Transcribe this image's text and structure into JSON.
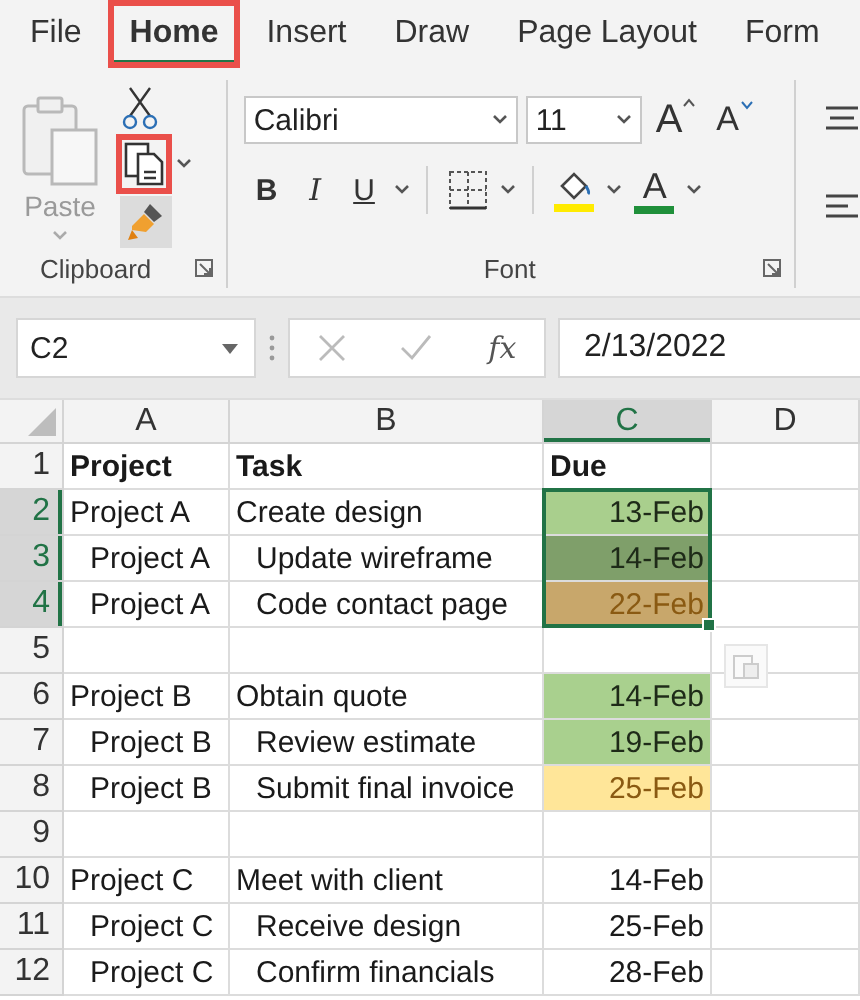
{
  "tabs": [
    {
      "label": "File",
      "selected": false,
      "highlighted": false
    },
    {
      "label": "Home",
      "selected": true,
      "highlighted": true
    },
    {
      "label": "Insert",
      "selected": false,
      "highlighted": false
    },
    {
      "label": "Draw",
      "selected": false,
      "highlighted": false
    },
    {
      "label": "Page Layout",
      "selected": false,
      "highlighted": false
    },
    {
      "label": "Form",
      "selected": false,
      "highlighted": false
    }
  ],
  "clipboard": {
    "paste_label": "Paste",
    "paste_disabled": true,
    "copy_highlighted": true,
    "group_label": "Clipboard"
  },
  "font": {
    "name": "Calibri",
    "size": "11",
    "grow": "A",
    "shrink": "A",
    "bold": "B",
    "italic": "I",
    "underline": "U",
    "font_color": "A",
    "group_label": "Font"
  },
  "formula_bar": {
    "name_box": "C2",
    "fx": "fx",
    "value": "2/13/2022"
  },
  "columns": [
    {
      "label": "A",
      "selected": false
    },
    {
      "label": "B",
      "selected": false
    },
    {
      "label": "C",
      "selected": true
    },
    {
      "label": "D",
      "selected": false
    }
  ],
  "rows": [
    {
      "number": "1",
      "kind": "header",
      "selected": false,
      "indented": false,
      "project": "Project",
      "task": "Task",
      "due": {
        "text": "Due"
      }
    },
    {
      "number": "2",
      "kind": "item",
      "selected": true,
      "indented": false,
      "project": "Project A",
      "task": "Create design",
      "due": {
        "text": "13-Feb",
        "color": "#a9cf8d",
        "kind": "good"
      }
    },
    {
      "number": "3",
      "kind": "item",
      "selected": true,
      "indented": true,
      "project": "Project A",
      "task": "Update wireframe",
      "due": {
        "text": "14-Feb",
        "color": "#7f9f6a",
        "kind": "good"
      }
    },
    {
      "number": "4",
      "kind": "item",
      "selected": true,
      "indented": true,
      "project": "Project A",
      "task": "Code contact page",
      "due": {
        "text": "22-Feb",
        "color": "#c8a76b",
        "kind": "neutral"
      }
    },
    {
      "number": "5",
      "kind": "blank",
      "selected": false,
      "paste_options": true
    },
    {
      "number": "6",
      "kind": "item",
      "selected": false,
      "indented": false,
      "project": "Project B",
      "task": "Obtain quote",
      "due": {
        "text": "14-Feb",
        "color": "#a9d08e",
        "kind": "good"
      }
    },
    {
      "number": "7",
      "kind": "item",
      "selected": false,
      "indented": true,
      "project": "Project B",
      "task": "Review estimate",
      "due": {
        "text": "19-Feb",
        "color": "#a9d08e",
        "kind": "good"
      }
    },
    {
      "number": "8",
      "kind": "item",
      "selected": false,
      "indented": true,
      "project": "Project B",
      "task": "Submit final invoice",
      "due": {
        "text": "25-Feb",
        "color": "#ffe699",
        "kind": "neutral"
      }
    },
    {
      "number": "9",
      "kind": "blank",
      "selected": false
    },
    {
      "number": "10",
      "kind": "item",
      "selected": false,
      "indented": false,
      "project": "Project C",
      "task": "Meet with client",
      "due": {
        "text": "14-Feb"
      }
    },
    {
      "number": "11",
      "kind": "item",
      "selected": false,
      "indented": true,
      "project": "Project C",
      "task": "Receive design",
      "due": {
        "text": "25-Feb"
      }
    },
    {
      "number": "12",
      "kind": "item",
      "selected": false,
      "indented": true,
      "project": "Project C",
      "task": "Confirm financials",
      "due": {
        "text": "28-Feb"
      }
    }
  ]
}
